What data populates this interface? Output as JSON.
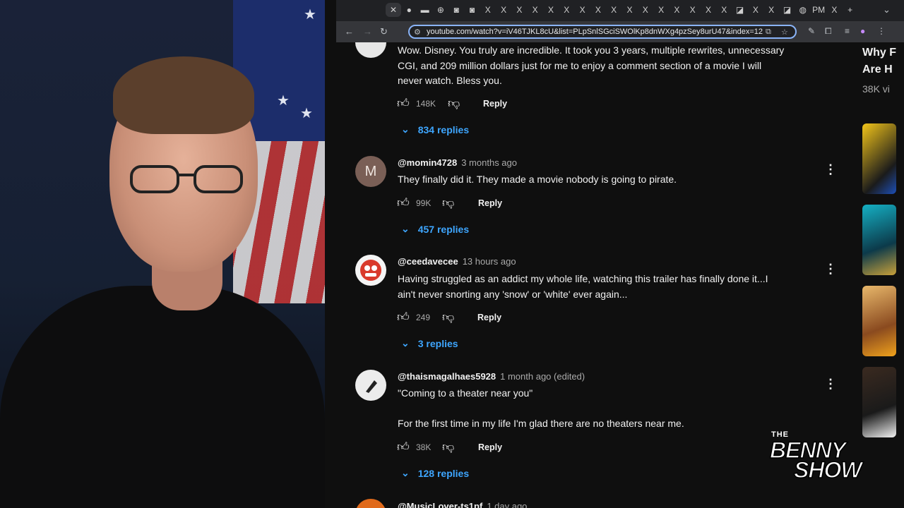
{
  "browser": {
    "url": "youtube.com/watch?v=iV46TJKL8cU&list=PLpSnlSGciSWOlKp8dnWXg4pzSey8urU47&index=12",
    "tabs": [
      "✕",
      "●",
      "▬",
      "⊕",
      "◙",
      "◙",
      "X",
      "X",
      "X",
      "X",
      "X",
      "X",
      "X",
      "X",
      "X",
      "X",
      "X",
      "X",
      "X",
      "X",
      "X",
      "X",
      "◪",
      "X",
      "X",
      "◪",
      "◍",
      "PM",
      "X",
      "+"
    ]
  },
  "comments": [
    {
      "handle": "",
      "time": "",
      "lines": [
        "Wow. Disney. You truly are incredible. It took you 3 years, multiple rewrites, unnecessary",
        "CGI, and 209 million dollars just for me to enjoy a comment section of a movie I will",
        "never watch. Bless you."
      ],
      "likes": "148K",
      "reply": "Reply",
      "replies": "834 replies"
    },
    {
      "handle": "@momin4728",
      "time": "3 months ago",
      "avatar_letter": "M",
      "lines": [
        "They finally did it. They made a movie nobody is going to pirate."
      ],
      "likes": "99K",
      "reply": "Reply",
      "replies": "457 replies"
    },
    {
      "handle": "@ceedavecee",
      "time": "13 hours ago",
      "lines": [
        "Having struggled as an addict my whole life, watching this trailer has finally done it...I",
        "ain't never snorting any 'snow' or 'white' ever again..."
      ],
      "likes": "249",
      "reply": "Reply",
      "replies": "3 replies"
    },
    {
      "handle": "@thaismagalhaes5928",
      "time": "1 month ago (edited)",
      "lines": [
        "\"Coming to a theater near you\"",
        "",
        "For the first time in my life I'm glad there are no theaters near me."
      ],
      "likes": "38K",
      "reply": "Reply",
      "replies": "128 replies"
    },
    {
      "handle": "@MusicLover-ts1pf",
      "time": "1 day ago"
    }
  ],
  "rail": {
    "title_line1": "Why F",
    "title_line2": "Are H",
    "views": "38K vi"
  },
  "logo": {
    "the": "THE",
    "word1": "BENNY",
    "word2": "SHOW"
  },
  "colors": {
    "link_blue": "#3ea6ff",
    "background": "#0f0f0f",
    "omnibox_border": "#8ab4f8"
  }
}
